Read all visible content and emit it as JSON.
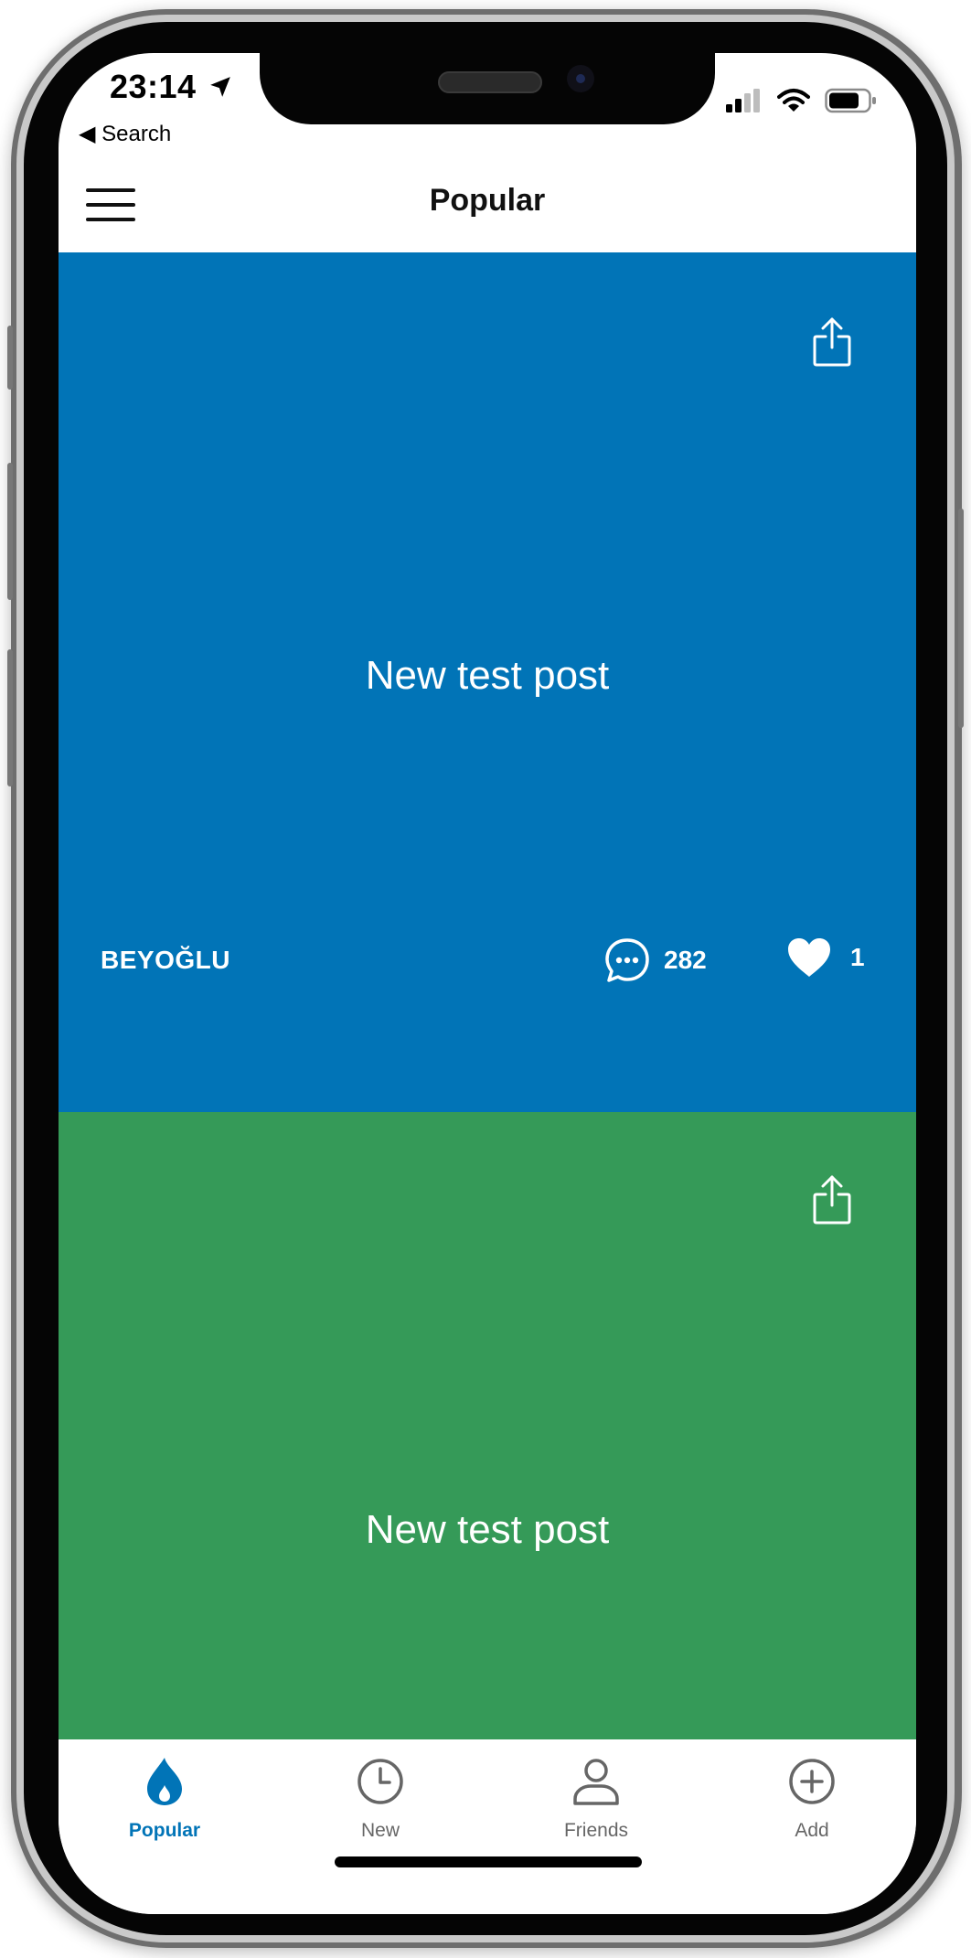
{
  "status_bar": {
    "time": "23:14",
    "back_label": "◀ Search"
  },
  "header": {
    "title": "Popular"
  },
  "posts": [
    {
      "text": "New test post",
      "color": "#0174b7",
      "location": "BEYOĞLU",
      "comments": "282",
      "likes": "1"
    },
    {
      "text": "New test post",
      "color": "#359a58"
    }
  ],
  "tabs": [
    {
      "label": "Popular",
      "icon": "flame-icon",
      "active": true
    },
    {
      "label": "New",
      "icon": "clock-icon",
      "active": false
    },
    {
      "label": "Friends",
      "icon": "person-icon",
      "active": false
    },
    {
      "label": "Add",
      "icon": "plus-circle-icon",
      "active": false
    }
  ],
  "colors": {
    "accent": "#0174b7",
    "inactive_tab": "#666666"
  }
}
